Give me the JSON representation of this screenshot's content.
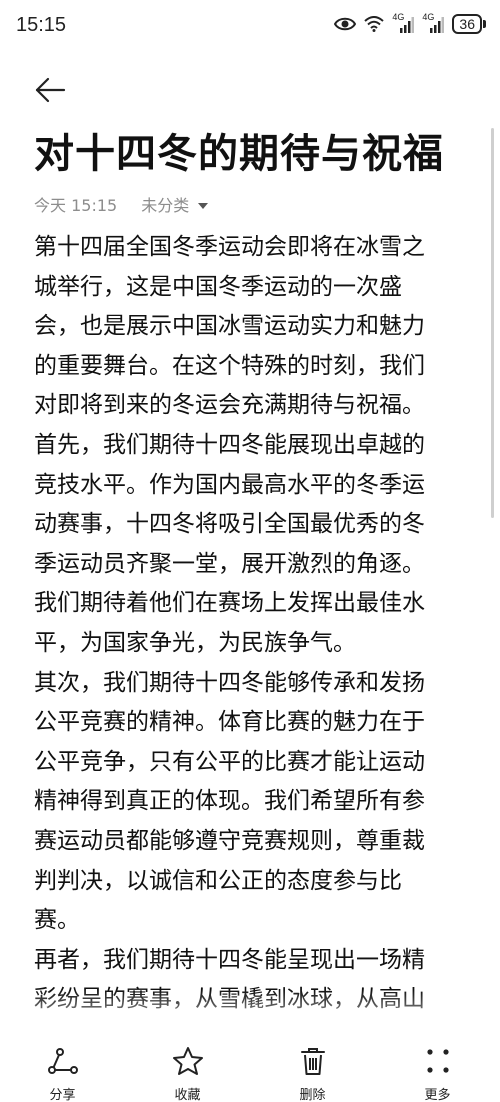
{
  "status_bar": {
    "time": "15:15",
    "battery": "36",
    "network_1": "4G",
    "network_2": "4G"
  },
  "note": {
    "title": "对十四冬的期待与祝福",
    "timestamp": "今天 15:15",
    "category": "未分类"
  },
  "content_lines": [
    "第十四届全国冬季运动会即将在冰雪之",
    "城举行，这是中国冬季运动的一次盛",
    "会，也是展示中国冰雪运动实力和魅力",
    "的重要舞台。在这个特殊的时刻，我们",
    "对即将到来的冬运会充满期待与祝福。",
    "首先，我们期待十四冬能展现出卓越的",
    "竞技水平。作为国内最高水平的冬季运",
    "动赛事，十四冬将吸引全国最优秀的冬",
    "季运动员齐聚一堂，展开激烈的角逐。",
    "我们期待着他们在赛场上发挥出最佳水",
    "平，为国家争光，为民族争气。",
    "其次，我们期待十四冬能够传承和发扬",
    "公平竞赛的精神。体育比赛的魅力在于",
    "公平竞争，只有公平的比赛才能让运动",
    "精神得到真正的体现。我们希望所有参",
    "赛运动员都能够遵守竞赛规则，尊重裁",
    "判判决，以诚信和公正的态度参与比",
    "赛。",
    "再者，我们期待十四冬能呈现出一场精",
    "彩纷呈的赛事，从雪橇到冰球，从高山"
  ],
  "bottom_bar": {
    "share": "分享",
    "favorite": "收藏",
    "delete": "删除",
    "more": "更多"
  }
}
